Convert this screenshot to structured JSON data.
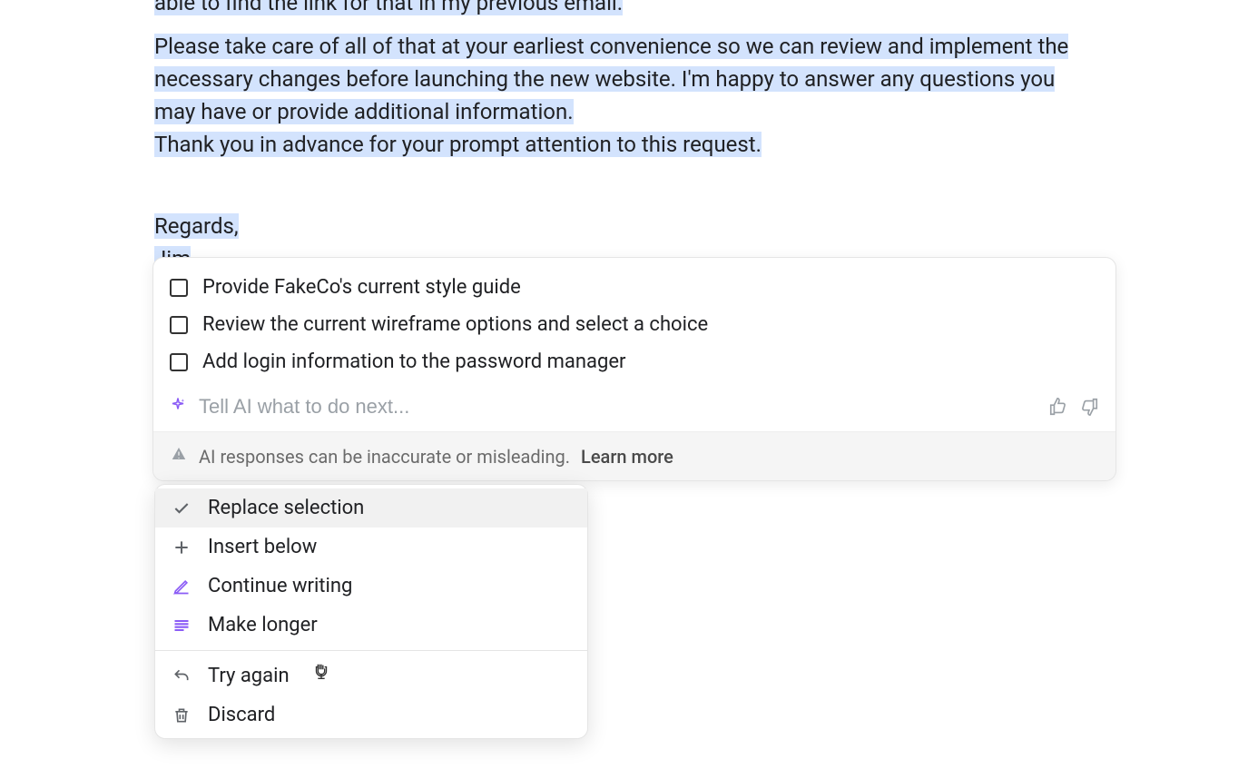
{
  "document": {
    "cut_off_line": "able to find the link for that in my previous email.",
    "paragraph1": "Please take care of all of that at your earliest convenience so we can review and implement the necessary changes before launching the new website. I'm happy to answer any questions you may have or provide additional information.",
    "paragraph2": "Thank you in advance for your prompt attention to this request.",
    "signoff": "Regards,",
    "name": "Jim"
  },
  "ai_panel": {
    "tasks": [
      {
        "label": "Provide FakeCo's current style guide"
      },
      {
        "label": "Review the current wireframe options and select a choice"
      },
      {
        "label": "Add login information to the password manager"
      }
    ],
    "input_placeholder": "Tell AI what to do next...",
    "footer_text": "AI responses can be inaccurate or misleading.",
    "learn_more": "Learn more"
  },
  "action_menu": {
    "items": [
      {
        "icon": "check",
        "label": "Replace selection",
        "highlighted": true
      },
      {
        "icon": "plus",
        "label": "Insert below"
      },
      {
        "icon": "pencil",
        "label": "Continue writing",
        "purple": true
      },
      {
        "icon": "lines",
        "label": "Make longer",
        "purple": true
      }
    ],
    "secondary": [
      {
        "icon": "undo",
        "label": "Try again"
      },
      {
        "icon": "trash",
        "label": "Discard"
      }
    ]
  }
}
